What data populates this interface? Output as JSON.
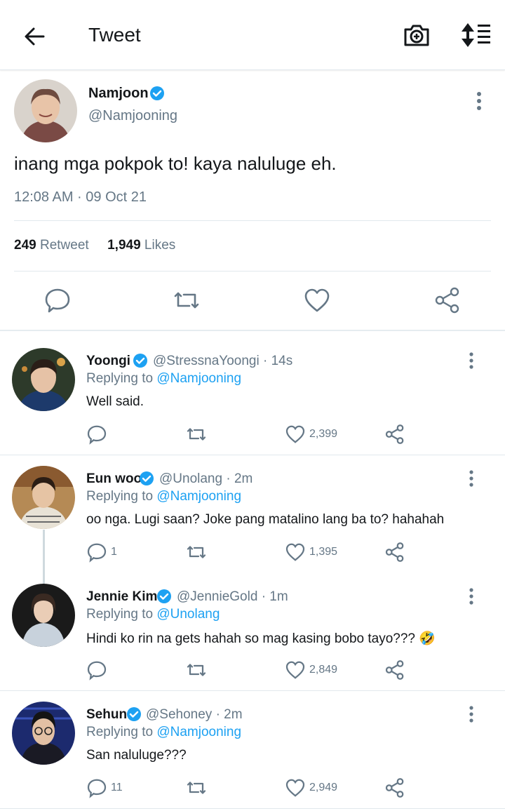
{
  "header": {
    "title": "Tweet"
  },
  "main_tweet": {
    "name": "Namjoon",
    "handle": "@Namjooning",
    "text": "inang mga pokpok to! kaya nalulugе eh.",
    "time": "12:08 AM · 09 Oct 21",
    "retweet_count": "249",
    "retweet_label": "Retweet",
    "like_count": "1,949",
    "like_label": "Likes"
  },
  "replies": [
    {
      "name": "Yoongi",
      "handle": "@StressnaYoongi · 14s",
      "replying_prefix": "Replying to",
      "replying_to": "@Namjooning",
      "text": "Well said.",
      "reply_count": "",
      "like_count": "2,399"
    },
    {
      "name": "Eun woo",
      "handle": "@Unolang · 2m",
      "replying_prefix": "Replying to",
      "replying_to": "@Namjooning",
      "text": "oo nga. Lugi saan? Joke pang matalino lang ba to? hahahah",
      "reply_count": "1",
      "like_count": "1,395"
    },
    {
      "name": "Jennie Kim",
      "handle": "@JennieGold · 1m",
      "replying_prefix": "Replying to",
      "replying_to": "@Unolang",
      "text": "Hindi ko rin na gets hahah so mag kasing bobo tayo??? 🤣",
      "reply_count": "",
      "like_count": "2,849"
    },
    {
      "name": "Sehun",
      "handle": "@Sehoney · 2m",
      "replying_prefix": "Replying to",
      "replying_to": "@Namjooning",
      "text": "San naluluge???",
      "reply_count": "11",
      "like_count": "2,949"
    }
  ],
  "colors": {
    "accent": "#1da1f2",
    "muted": "#657786",
    "text": "#14171a",
    "divider": "#e1e8ed"
  },
  "icons": [
    "back-arrow-icon",
    "camera-plus-icon",
    "sort-icon",
    "verified-icon",
    "more-vertical-icon",
    "reply-icon",
    "retweet-icon",
    "like-icon",
    "share-icon"
  ]
}
